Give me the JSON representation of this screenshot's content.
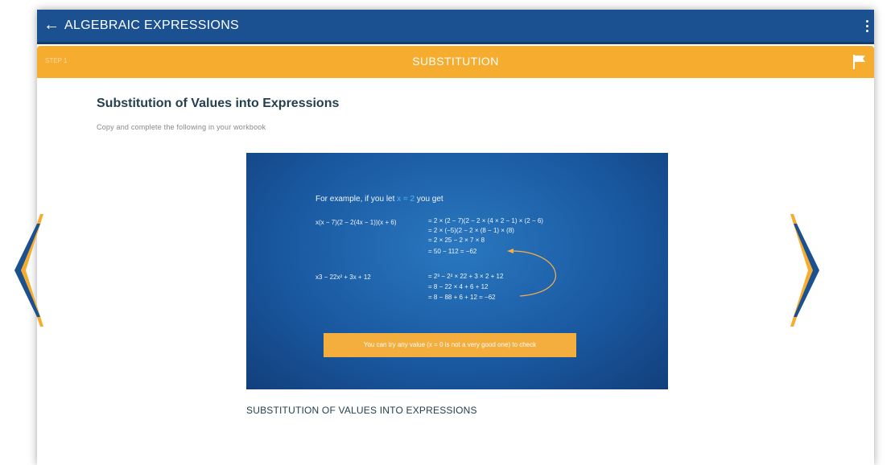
{
  "app_bar": {
    "back_icon": "back-arrow-icon",
    "title": "ALGEBRAIC EXPRESSIONS",
    "menu_icon": "more-vertical-icon"
  },
  "section_bar": {
    "left_label": "STEP 1",
    "title": "SUBSTITUTION",
    "flag_icon": "flag-icon"
  },
  "content": {
    "title": "Substitution of Values into Expressions",
    "instruction": "Copy and complete the following in your workbook",
    "slide": {
      "intro_prefix": "For example, if you let ",
      "intro_value": "x = 2",
      "intro_suffix": " you get",
      "expr1": "x(x − 7)(2 − 2(4x − 1))(x + 6)",
      "expr1_steps": [
        "= 2 × (2 − 7)(2 − 2 × (4 × 2 − 1) × (2 − 6)",
        "= 2 × (−5)(2 − 2 × (8 − 1) × (8)",
        "= 2 × 25 − 2 × 7 × 8",
        "= 50 − 112  =  −62"
      ],
      "expr2": "x3 − 22x² + 3x + 12",
      "expr2_steps": [
        "= 2³ − 2² × 22 + 3 × 2 + 12",
        "= 8 − 22 × 4 + 6 + 12",
        "= 8 − 88 + 6 + 12  = −62"
      ],
      "note": "You can try any value (x = 0 is not a very good one) to check"
    },
    "caption": "SUBSTITUTION OF VALUES INTO EXPRESSIONS"
  },
  "navigation": {
    "prev_icon": "chevron-left-icon",
    "next_icon": "chevron-right-icon"
  },
  "colors": {
    "primary": "#1b5191",
    "accent": "#f6ac2f",
    "slide_bg": "#1a5aa2",
    "highlight": "#4fb8f2"
  }
}
